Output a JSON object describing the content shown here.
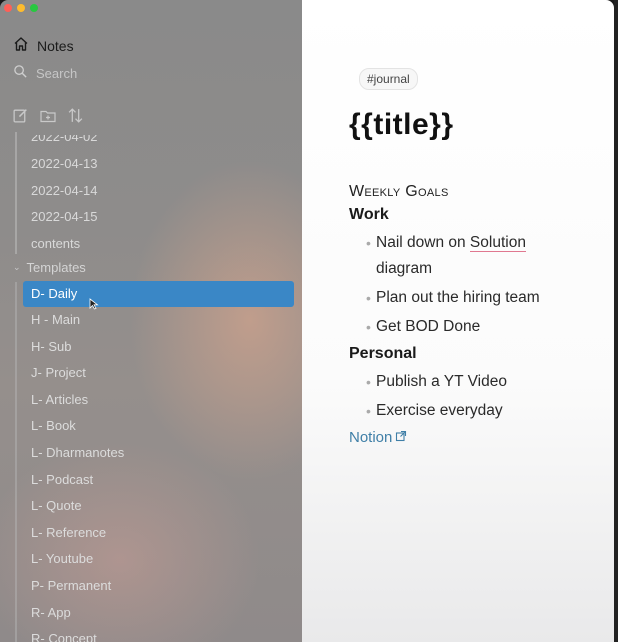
{
  "sidebar": {
    "nav": [
      {
        "label": "Notes",
        "icon": "home-icon"
      },
      {
        "label": "Search",
        "icon": "search-icon"
      }
    ],
    "toolbar_icons": [
      "new-note-icon",
      "new-folder-icon",
      "sort-icon"
    ],
    "date_items": [
      "2022-04-02",
      "2022-04-13",
      "2022-04-14",
      "2022-04-15",
      "contents"
    ],
    "folder": {
      "label": "Templates",
      "expanded": true
    },
    "templates": [
      {
        "label": "D- Daily",
        "selected": true
      },
      {
        "label": "H - Main"
      },
      {
        "label": "H- Sub"
      },
      {
        "label": "J- Project"
      },
      {
        "label": "L- Articles"
      },
      {
        "label": "L- Book"
      },
      {
        "label": "L- Dharmanotes"
      },
      {
        "label": "L- Podcast"
      },
      {
        "label": "L- Quote"
      },
      {
        "label": "L- Reference"
      },
      {
        "label": "L- Youtube"
      },
      {
        "label": "P- Permanent"
      },
      {
        "label": "R- App"
      },
      {
        "label": "R- Concept"
      }
    ]
  },
  "editor": {
    "tag": "#journal",
    "title": "{{title}}",
    "heading_goals": "Weekly Goals",
    "heading_work": "Work",
    "work_items": [
      "Nail down on",
      "Solution",
      "diagram",
      "Plan out the hiring team",
      "Get BOD Done"
    ],
    "heading_personal": "Personal",
    "personal_items": [
      "Publish a YT Video",
      "Exercise everyday"
    ],
    "link": "Notion"
  },
  "colors": {
    "selection": "#3a87c6",
    "link": "#3f7fa7",
    "spellcheck": "#e07890"
  }
}
